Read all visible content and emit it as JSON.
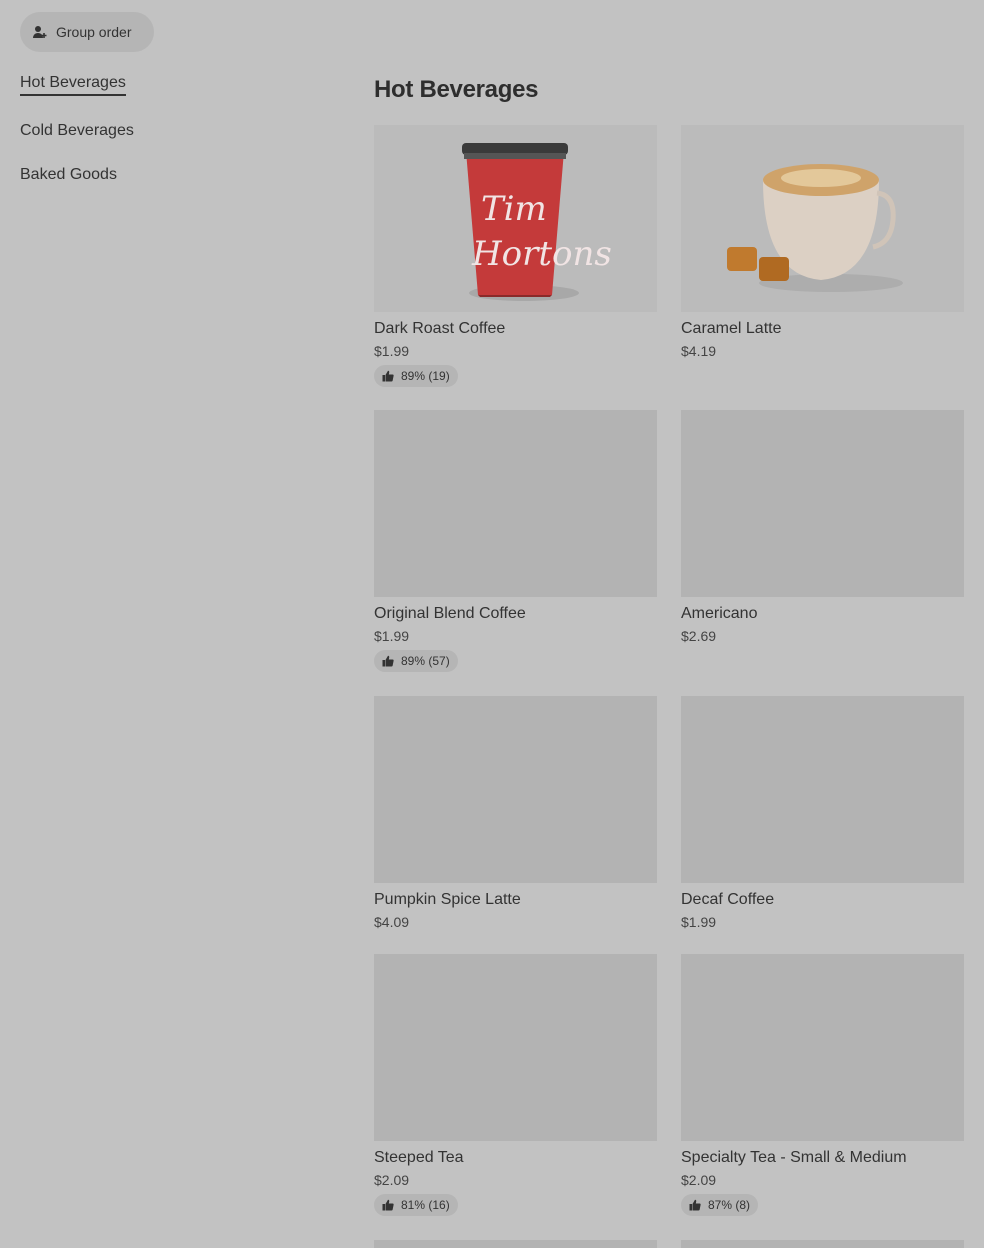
{
  "header": {
    "group_order_label": "Group order"
  },
  "sidebar": {
    "items": [
      {
        "label": "Hot Beverages",
        "active": true
      },
      {
        "label": "Cold Beverages",
        "active": false
      },
      {
        "label": "Baked Goods",
        "active": false
      }
    ]
  },
  "main": {
    "section_title": "Hot Beverages",
    "cup_logo_text": [
      "Tim",
      "Hortons"
    ],
    "items": [
      {
        "name": "Dark Roast Coffee",
        "price": "$1.99",
        "rating": "89% (19)",
        "image": "coffee-cup"
      },
      {
        "name": "Caramel Latte",
        "price": "$4.19",
        "rating": "",
        "image": "latte-mug"
      },
      {
        "name": "Original Blend Coffee",
        "price": "$1.99",
        "rating": "89% (57)",
        "image": ""
      },
      {
        "name": "Americano",
        "price": "$2.69",
        "rating": "",
        "image": ""
      },
      {
        "name": "Pumpkin Spice Latte",
        "price": "$4.09",
        "rating": "",
        "image": ""
      },
      {
        "name": "Decaf Coffee",
        "price": "$1.99",
        "rating": "",
        "image": ""
      },
      {
        "name": "Steeped Tea",
        "price": "$2.09",
        "rating": "81% (16)",
        "image": ""
      },
      {
        "name": "Specialty Tea - Small & Medium",
        "price": "$2.09",
        "rating": "87% (8)",
        "image": ""
      }
    ]
  },
  "colors": {
    "background": "#c2c2c2",
    "placeholder": "#b3b3b3",
    "cup_red": "#c43a3a"
  }
}
